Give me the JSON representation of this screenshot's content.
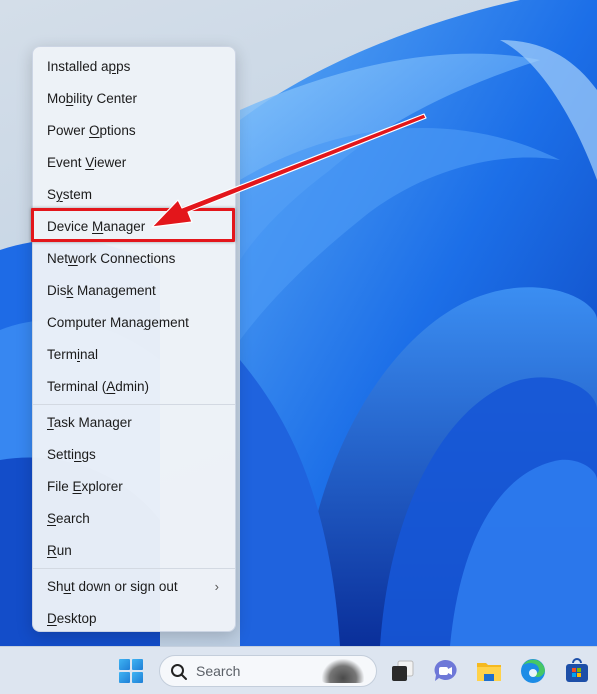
{
  "context_menu": {
    "groups": [
      [
        {
          "pre": "Installed a",
          "u": "p",
          "post": "ps"
        },
        {
          "pre": "Mo",
          "u": "b",
          "post": "ility Center"
        },
        {
          "pre": "Power ",
          "u": "O",
          "post": "ptions"
        },
        {
          "pre": "Event ",
          "u": "V",
          "post": "iewer"
        },
        {
          "pre": "S",
          "u": "y",
          "post": "stem"
        },
        {
          "pre": "Device ",
          "u": "M",
          "post": "anager"
        },
        {
          "pre": "Net",
          "u": "w",
          "post": "ork Connections"
        },
        {
          "pre": "Dis",
          "u": "k",
          "post": " Management"
        },
        {
          "pre": "Computer Mana",
          "u": "g",
          "post": "ement"
        },
        {
          "pre": "Term",
          "u": "i",
          "post": "nal"
        },
        {
          "pre": "Terminal (",
          "u": "A",
          "post": "dmin)"
        }
      ],
      [
        {
          "pre": "",
          "u": "T",
          "post": "ask Manager"
        },
        {
          "pre": "Setti",
          "u": "n",
          "post": "gs"
        },
        {
          "pre": "File ",
          "u": "E",
          "post": "xplorer"
        },
        {
          "pre": "",
          "u": "S",
          "post": "earch"
        },
        {
          "pre": "",
          "u": "R",
          "post": "un"
        }
      ],
      [
        {
          "pre": "Sh",
          "u": "u",
          "post": "t down or sign out",
          "submenu_icon": "›"
        },
        {
          "pre": "",
          "u": "D",
          "post": "esktop"
        }
      ]
    ],
    "highlighted_item": "Device Manager"
  },
  "annotation": {
    "color": "#e3161b",
    "target": "Device Manager"
  },
  "taskbar": {
    "search_placeholder": "Search",
    "icons": [
      "start-icon",
      "search-icon",
      "task-view-icon",
      "chat-icon",
      "file-explorer-icon",
      "edge-icon",
      "store-icon"
    ]
  }
}
